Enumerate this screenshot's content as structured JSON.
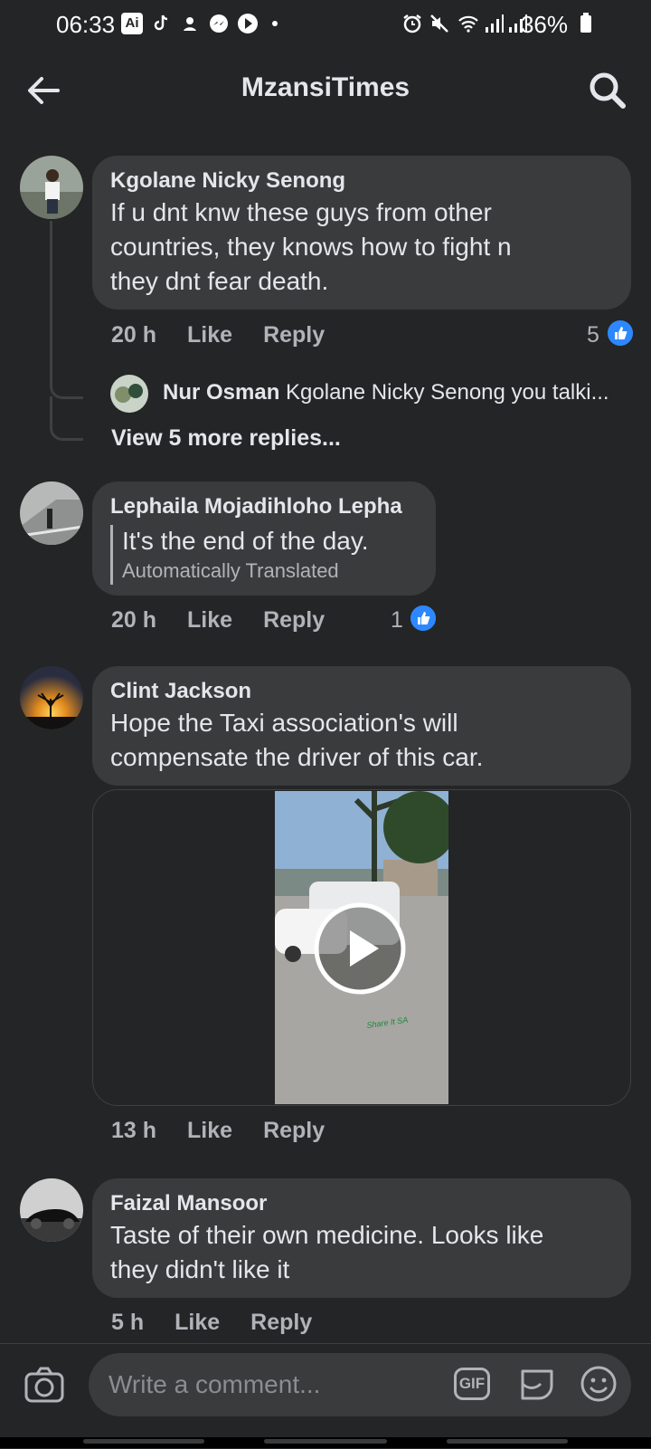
{
  "status_bar": {
    "time": "06:33",
    "app_badge": "Ai",
    "battery": "36%"
  },
  "header": {
    "title": "MzansiTimes"
  },
  "comments": [
    {
      "name": "Kgolane Nicky Senong",
      "lines": [
        "If u dnt knw these guys from other",
        "countries,  they knows how to fight n",
        "they dnt fear death."
      ],
      "time": "20 h",
      "like": "Like",
      "reply": "Reply",
      "likes": "5",
      "reply_preview": {
        "name": "Nur Osman",
        "text": "Kgolane Nicky Senong you talki..."
      },
      "view_more": "View 5 more replies..."
    },
    {
      "name": "Lephaila Mojadihloho Lepha",
      "text": "It's the end of the day.",
      "translated_note": "Automatically Translated",
      "time": "20 h",
      "like": "Like",
      "reply": "Reply",
      "likes": "1"
    },
    {
      "name": "Clint Jackson",
      "lines": [
        "Hope the Taxi association's will",
        "compensate the driver of this car."
      ],
      "video_watermark": "Share It SA",
      "time": "13 h",
      "like": "Like",
      "reply": "Reply"
    },
    {
      "name": "Faizal Mansoor",
      "lines": [
        "Taste of their own medicine. Looks like",
        "they didn't like it"
      ],
      "time": "5 h",
      "like": "Like",
      "reply": "Reply"
    }
  ],
  "composer": {
    "placeholder": "Write a comment...",
    "gif_label": "GIF"
  },
  "colors": {
    "background": "#242526",
    "bubble": "#3a3b3c",
    "like_blue": "#2d88ff"
  }
}
